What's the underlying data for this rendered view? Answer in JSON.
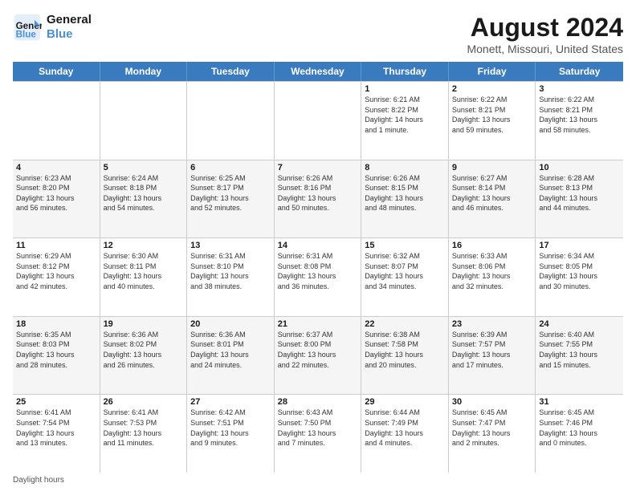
{
  "logo": {
    "line1": "General",
    "line2": "Blue"
  },
  "title": "August 2024",
  "location": "Monett, Missouri, United States",
  "weekdays": [
    "Sunday",
    "Monday",
    "Tuesday",
    "Wednesday",
    "Thursday",
    "Friday",
    "Saturday"
  ],
  "footer": "Daylight hours",
  "weeks": [
    [
      {
        "day": "",
        "text": ""
      },
      {
        "day": "",
        "text": ""
      },
      {
        "day": "",
        "text": ""
      },
      {
        "day": "",
        "text": ""
      },
      {
        "day": "1",
        "text": "Sunrise: 6:21 AM\nSunset: 8:22 PM\nDaylight: 14 hours\nand 1 minute."
      },
      {
        "day": "2",
        "text": "Sunrise: 6:22 AM\nSunset: 8:21 PM\nDaylight: 13 hours\nand 59 minutes."
      },
      {
        "day": "3",
        "text": "Sunrise: 6:22 AM\nSunset: 8:21 PM\nDaylight: 13 hours\nand 58 minutes."
      }
    ],
    [
      {
        "day": "4",
        "text": "Sunrise: 6:23 AM\nSunset: 8:20 PM\nDaylight: 13 hours\nand 56 minutes."
      },
      {
        "day": "5",
        "text": "Sunrise: 6:24 AM\nSunset: 8:18 PM\nDaylight: 13 hours\nand 54 minutes."
      },
      {
        "day": "6",
        "text": "Sunrise: 6:25 AM\nSunset: 8:17 PM\nDaylight: 13 hours\nand 52 minutes."
      },
      {
        "day": "7",
        "text": "Sunrise: 6:26 AM\nSunset: 8:16 PM\nDaylight: 13 hours\nand 50 minutes."
      },
      {
        "day": "8",
        "text": "Sunrise: 6:26 AM\nSunset: 8:15 PM\nDaylight: 13 hours\nand 48 minutes."
      },
      {
        "day": "9",
        "text": "Sunrise: 6:27 AM\nSunset: 8:14 PM\nDaylight: 13 hours\nand 46 minutes."
      },
      {
        "day": "10",
        "text": "Sunrise: 6:28 AM\nSunset: 8:13 PM\nDaylight: 13 hours\nand 44 minutes."
      }
    ],
    [
      {
        "day": "11",
        "text": "Sunrise: 6:29 AM\nSunset: 8:12 PM\nDaylight: 13 hours\nand 42 minutes."
      },
      {
        "day": "12",
        "text": "Sunrise: 6:30 AM\nSunset: 8:11 PM\nDaylight: 13 hours\nand 40 minutes."
      },
      {
        "day": "13",
        "text": "Sunrise: 6:31 AM\nSunset: 8:10 PM\nDaylight: 13 hours\nand 38 minutes."
      },
      {
        "day": "14",
        "text": "Sunrise: 6:31 AM\nSunset: 8:08 PM\nDaylight: 13 hours\nand 36 minutes."
      },
      {
        "day": "15",
        "text": "Sunrise: 6:32 AM\nSunset: 8:07 PM\nDaylight: 13 hours\nand 34 minutes."
      },
      {
        "day": "16",
        "text": "Sunrise: 6:33 AM\nSunset: 8:06 PM\nDaylight: 13 hours\nand 32 minutes."
      },
      {
        "day": "17",
        "text": "Sunrise: 6:34 AM\nSunset: 8:05 PM\nDaylight: 13 hours\nand 30 minutes."
      }
    ],
    [
      {
        "day": "18",
        "text": "Sunrise: 6:35 AM\nSunset: 8:03 PM\nDaylight: 13 hours\nand 28 minutes."
      },
      {
        "day": "19",
        "text": "Sunrise: 6:36 AM\nSunset: 8:02 PM\nDaylight: 13 hours\nand 26 minutes."
      },
      {
        "day": "20",
        "text": "Sunrise: 6:36 AM\nSunset: 8:01 PM\nDaylight: 13 hours\nand 24 minutes."
      },
      {
        "day": "21",
        "text": "Sunrise: 6:37 AM\nSunset: 8:00 PM\nDaylight: 13 hours\nand 22 minutes."
      },
      {
        "day": "22",
        "text": "Sunrise: 6:38 AM\nSunset: 7:58 PM\nDaylight: 13 hours\nand 20 minutes."
      },
      {
        "day": "23",
        "text": "Sunrise: 6:39 AM\nSunset: 7:57 PM\nDaylight: 13 hours\nand 17 minutes."
      },
      {
        "day": "24",
        "text": "Sunrise: 6:40 AM\nSunset: 7:55 PM\nDaylight: 13 hours\nand 15 minutes."
      }
    ],
    [
      {
        "day": "25",
        "text": "Sunrise: 6:41 AM\nSunset: 7:54 PM\nDaylight: 13 hours\nand 13 minutes."
      },
      {
        "day": "26",
        "text": "Sunrise: 6:41 AM\nSunset: 7:53 PM\nDaylight: 13 hours\nand 11 minutes."
      },
      {
        "day": "27",
        "text": "Sunrise: 6:42 AM\nSunset: 7:51 PM\nDaylight: 13 hours\nand 9 minutes."
      },
      {
        "day": "28",
        "text": "Sunrise: 6:43 AM\nSunset: 7:50 PM\nDaylight: 13 hours\nand 7 minutes."
      },
      {
        "day": "29",
        "text": "Sunrise: 6:44 AM\nSunset: 7:49 PM\nDaylight: 13 hours\nand 4 minutes."
      },
      {
        "day": "30",
        "text": "Sunrise: 6:45 AM\nSunset: 7:47 PM\nDaylight: 13 hours\nand 2 minutes."
      },
      {
        "day": "31",
        "text": "Sunrise: 6:45 AM\nSunset: 7:46 PM\nDaylight: 13 hours\nand 0 minutes."
      }
    ]
  ]
}
